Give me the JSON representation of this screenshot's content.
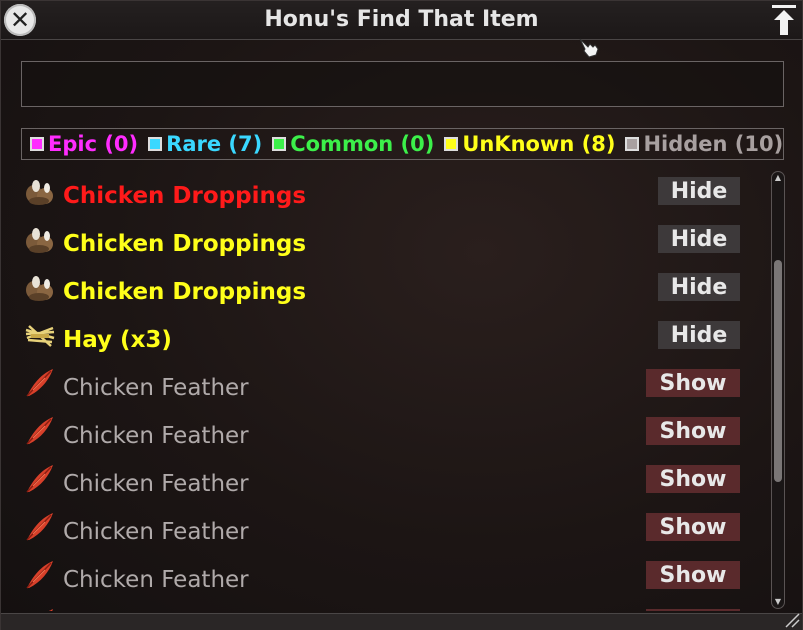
{
  "window": {
    "title": "Honu's Find That Item"
  },
  "search": {
    "value": "",
    "placeholder": ""
  },
  "filters": [
    {
      "label": "Epic (0)",
      "color": "#ff2cff"
    },
    {
      "label": "Rare (7)",
      "color": "#3ad8ff"
    },
    {
      "label": "Common (0)",
      "color": "#3cf04a"
    },
    {
      "label": "UnKnown (8)",
      "color": "#ffff1a"
    },
    {
      "label": "Hidden (10)",
      "color": "#a8a0a0"
    }
  ],
  "items": [
    {
      "name": "Chicken Droppings",
      "color": "#ff1a1a",
      "icon": "droppings-icon",
      "action": "Hide",
      "hidden": false
    },
    {
      "name": "Chicken Droppings",
      "color": "#ffff1a",
      "icon": "droppings-icon",
      "action": "Hide",
      "hidden": false
    },
    {
      "name": "Chicken Droppings",
      "color": "#ffff1a",
      "icon": "droppings-icon",
      "action": "Hide",
      "hidden": false
    },
    {
      "name": "Hay (x3)",
      "color": "#ffff1a",
      "icon": "hay-icon",
      "action": "Hide",
      "hidden": false
    },
    {
      "name": "Chicken Feather",
      "color": "#b0aaaa",
      "icon": "feather-icon",
      "action": "Show",
      "hidden": true
    },
    {
      "name": "Chicken Feather",
      "color": "#b0aaaa",
      "icon": "feather-icon",
      "action": "Show",
      "hidden": true
    },
    {
      "name": "Chicken Feather",
      "color": "#b0aaaa",
      "icon": "feather-icon",
      "action": "Show",
      "hidden": true
    },
    {
      "name": "Chicken Feather",
      "color": "#b0aaaa",
      "icon": "feather-icon",
      "action": "Show",
      "hidden": true
    },
    {
      "name": "Chicken Feather",
      "color": "#b0aaaa",
      "icon": "feather-icon",
      "action": "Show",
      "hidden": true
    },
    {
      "name": "",
      "color": "#b0aaaa",
      "icon": "feather-icon",
      "action": "",
      "hidden": true
    }
  ]
}
